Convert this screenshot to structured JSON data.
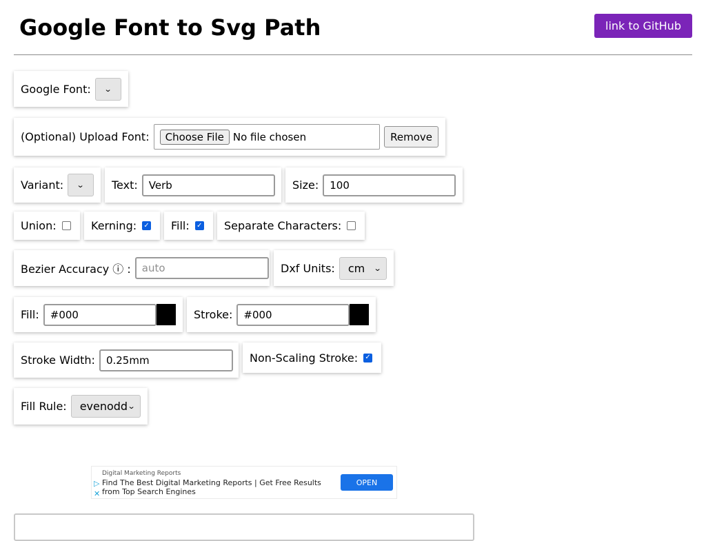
{
  "header": {
    "title": "Google Font to Svg Path",
    "github_label": "link to GitHub"
  },
  "font_row": {
    "label": "Google Font:"
  },
  "upload_row": {
    "label": "(Optional) Upload Font:",
    "choose_file_label": "Choose File",
    "no_file_text": "No file chosen",
    "remove_label": "Remove"
  },
  "variant": {
    "label": "Variant:"
  },
  "text_field": {
    "label": "Text:",
    "value": "Verb"
  },
  "size_field": {
    "label": "Size:",
    "value": "100"
  },
  "options": {
    "union": {
      "label": "Union:",
      "checked": false
    },
    "kerning": {
      "label": "Kerning:",
      "checked": true
    },
    "fill": {
      "label": "Fill:",
      "checked": true
    },
    "separate": {
      "label": "Separate Characters:",
      "checked": false
    }
  },
  "bezier": {
    "label": "Bezier Accuracy ⓘ :",
    "placeholder": "auto"
  },
  "dxf_units": {
    "label": "Dxf Units:",
    "selected": "cm"
  },
  "fill_color": {
    "label": "Fill:",
    "value": "#000",
    "swatch": "#000000"
  },
  "stroke_color": {
    "label": "Stroke:",
    "value": "#000",
    "swatch": "#000000"
  },
  "stroke_width": {
    "label": "Stroke Width:",
    "value": "0.25mm"
  },
  "non_scaling": {
    "label": "Non-Scaling Stroke:",
    "checked": true
  },
  "fill_rule": {
    "label": "Fill Rule:",
    "selected": "evenodd"
  },
  "ad": {
    "small_text": "Digital Marketing Reports",
    "headline": "Find The Best Digital Marketing Reports | Get Free Results from Top Search Engines",
    "open_label": "OPEN"
  },
  "colors": {
    "accent": "#7b24b8",
    "checkbox": "#0b5fe0",
    "ad_button": "#1a73e8"
  }
}
